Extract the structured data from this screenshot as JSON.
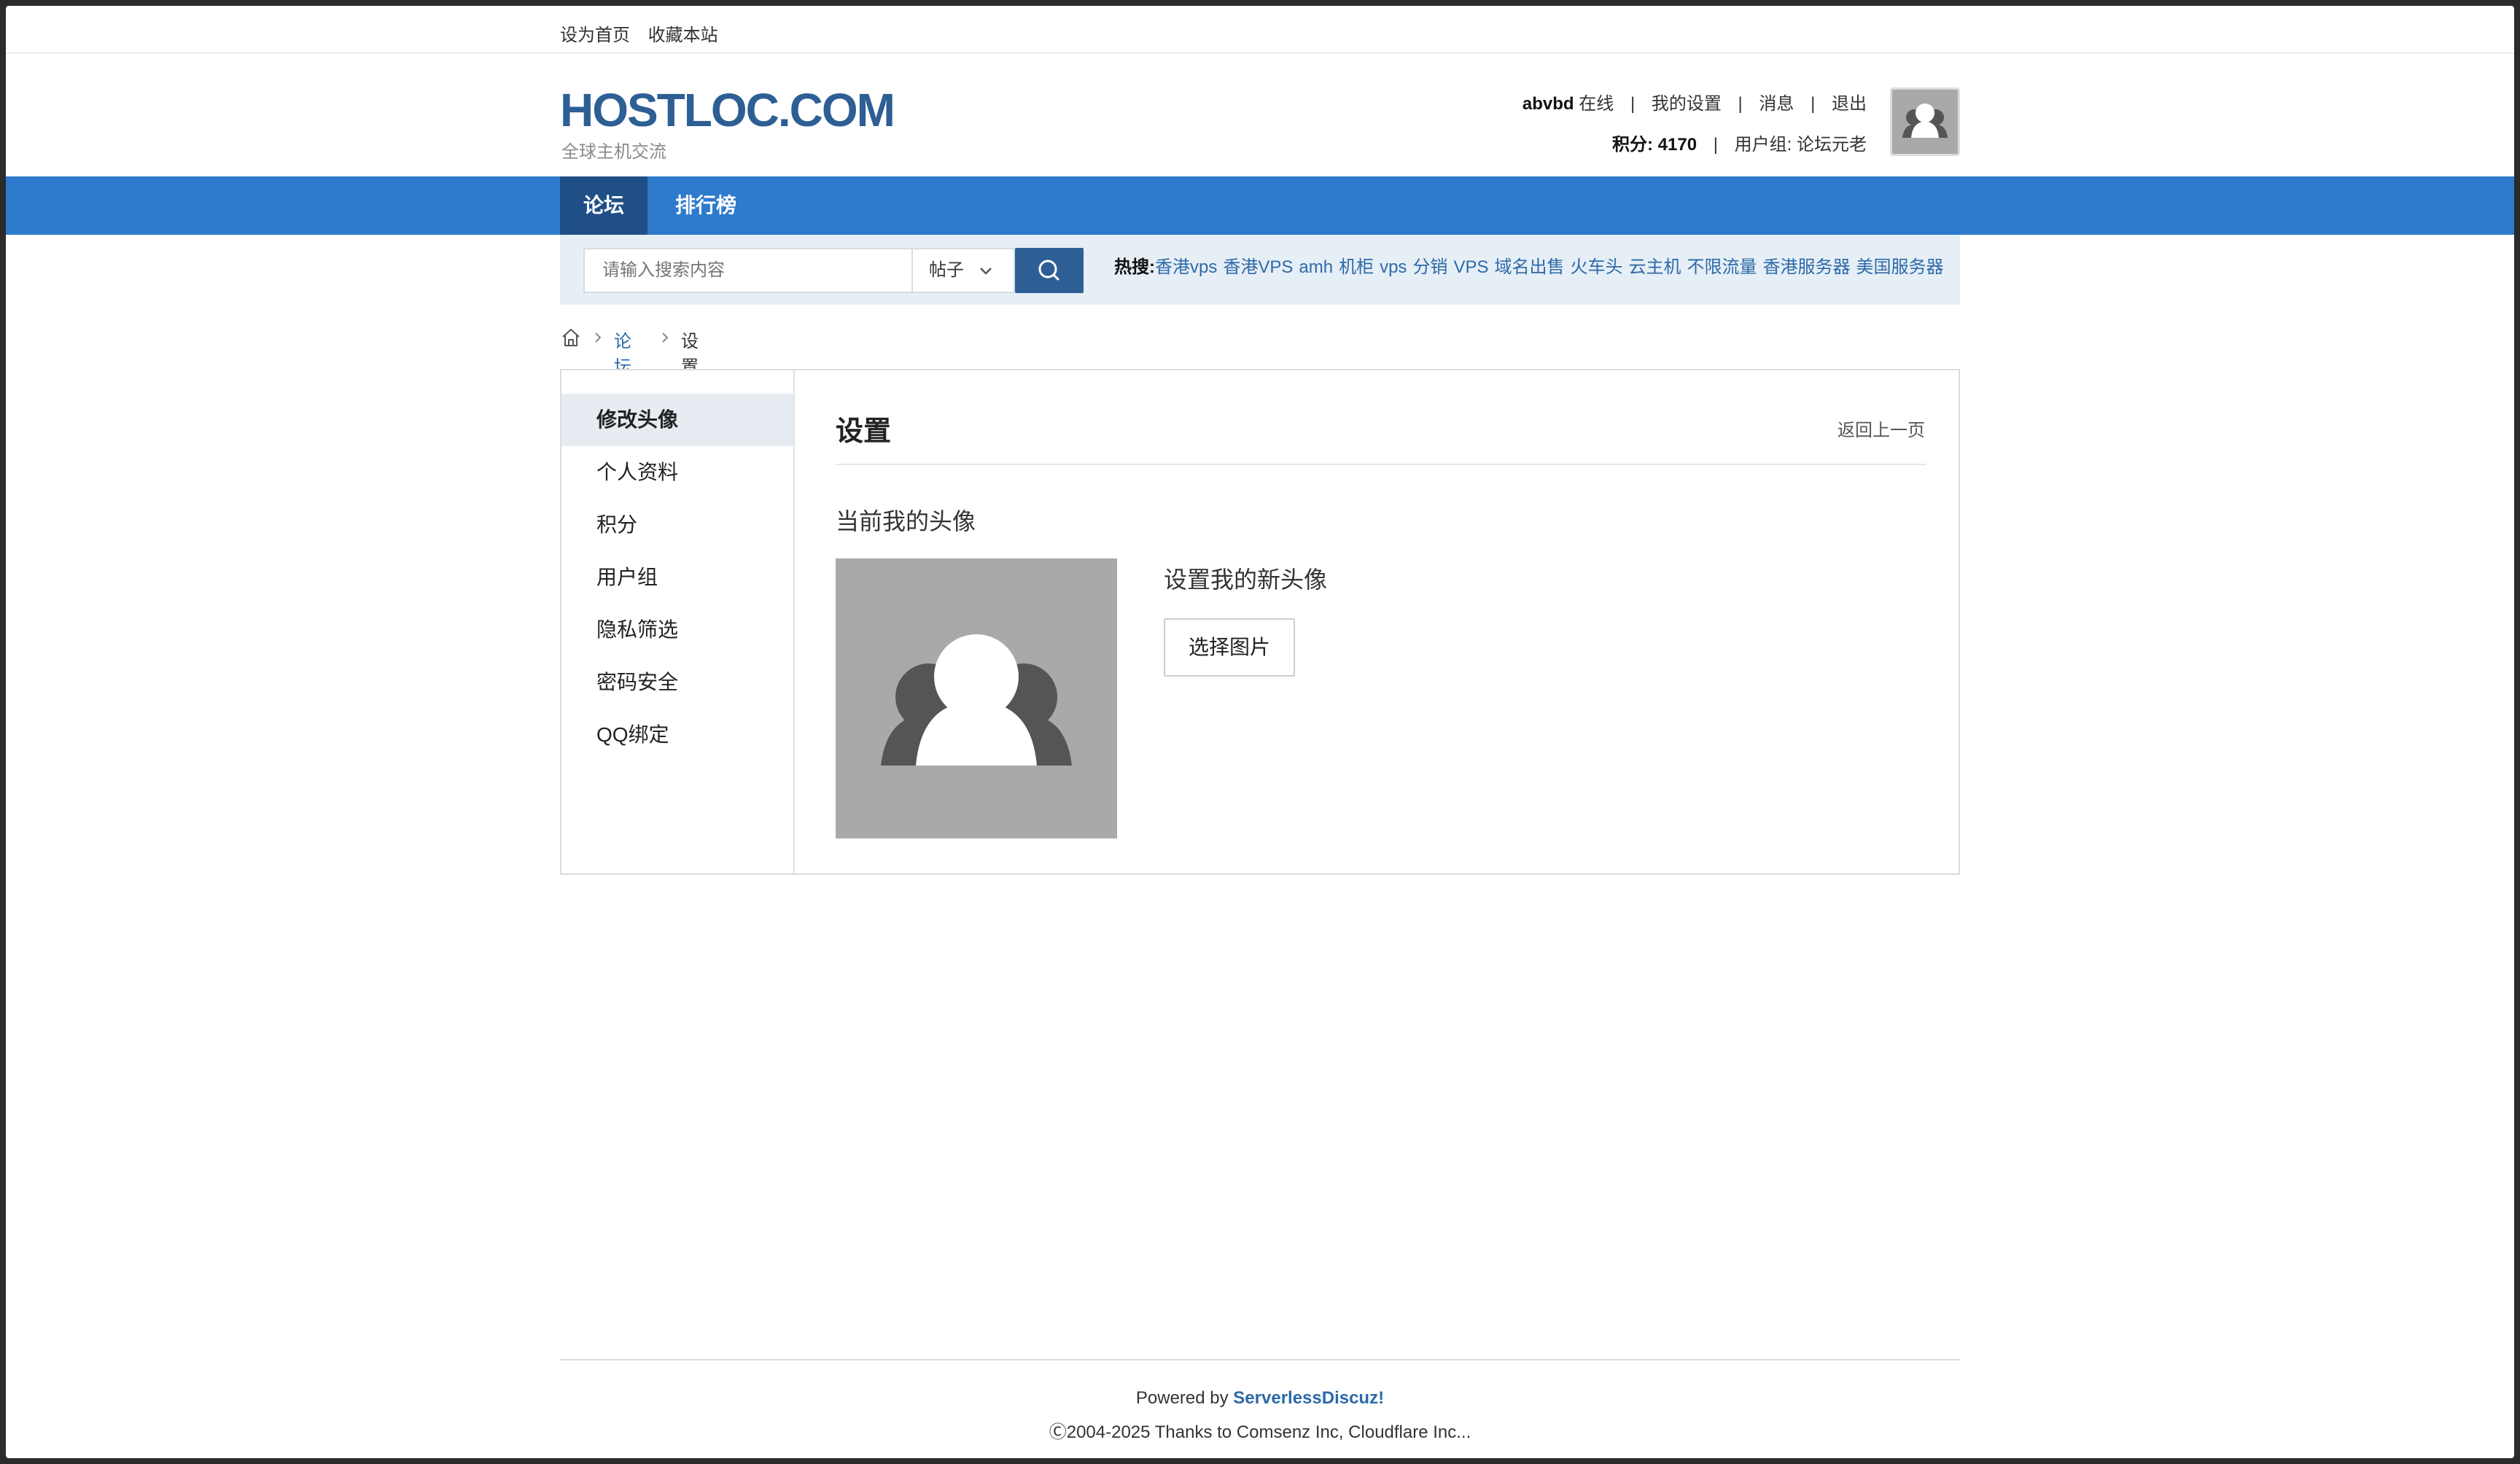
{
  "topbar": {
    "set_home": "设为首页",
    "bookmark": "收藏本站"
  },
  "header": {
    "logo": "HOSTLOC.COM",
    "slogan": "全球主机交流",
    "username": "abvbd",
    "online": "在线",
    "my_settings": "我的设置",
    "messages": "消息",
    "logout": "退出",
    "points_label": "积分: 4170",
    "usergroup_label": "用户组: 论坛元老",
    "separator": "|"
  },
  "nav": {
    "items": [
      {
        "label": "论坛",
        "active": true
      },
      {
        "label": "排行榜",
        "active": false
      }
    ]
  },
  "search": {
    "placeholder": "请输入搜索内容",
    "type": "帖子",
    "button_icon": "search-icon",
    "hot_label": "热搜:",
    "hot_words": [
      "香港vps",
      "香港VPS",
      "amh",
      "机柜",
      "vps",
      "分销",
      "VPS",
      "域名出售",
      "火车头",
      "云主机",
      "不限流量",
      "香港服务器",
      "美国服务器"
    ]
  },
  "breadcrumb": {
    "home_icon": "home-icon",
    "forum": "论坛",
    "current": "设置"
  },
  "sidebar": {
    "items": [
      {
        "label": "修改头像",
        "active": true
      },
      {
        "label": "个人资料",
        "active": false
      },
      {
        "label": "积分",
        "active": false
      },
      {
        "label": "用户组",
        "active": false
      },
      {
        "label": "隐私筛选",
        "active": false
      },
      {
        "label": "密码安全",
        "active": false
      },
      {
        "label": "QQ绑定",
        "active": false
      }
    ]
  },
  "content": {
    "title": "设置",
    "back": "返回上一页",
    "current_avatar_label": "当前我的头像",
    "new_avatar_label": "设置我的新头像",
    "choose_button": "选择图片"
  },
  "footer": {
    "powered_prefix": "Powered by ",
    "powered_name": "ServerlessDiscuz!",
    "copyright": "Ⓒ2004-2025 Thanks to Comsenz Inc, Cloudflare Inc..."
  },
  "colors": {
    "brand": "#2d5f95",
    "nav_bg": "#2e7acc",
    "nav_active": "#1f4f86",
    "link": "#2d6aa8",
    "search_band": "#e6eef6"
  }
}
